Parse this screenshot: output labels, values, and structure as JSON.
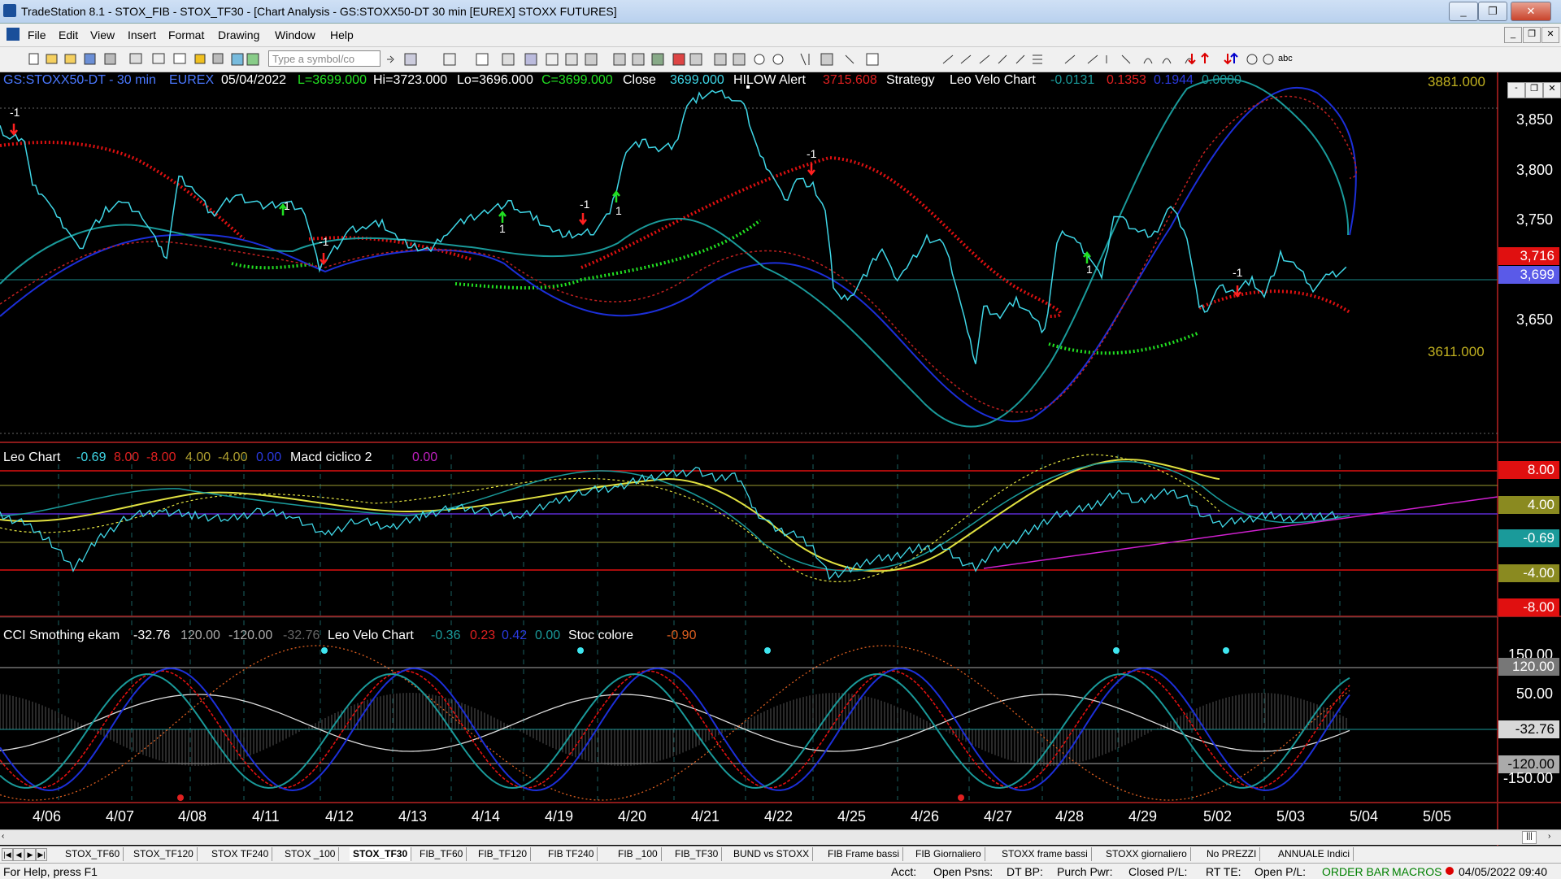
{
  "window": {
    "title": "TradeStation 8.1 - STOX_FIB - STOX_TF30 - [Chart Analysis - GS:STOXX50-DT  30 min  [EUREX] STOXX FUTURES]",
    "controls": [
      "_",
      "❐",
      "✕"
    ]
  },
  "menu": [
    "File",
    "Edit",
    "View",
    "Insert",
    "Format",
    "Drawing",
    "Window",
    "Help"
  ],
  "toolbar": {
    "symbol_placeholder": "Type a symbol/co",
    "abc_label": "abc"
  },
  "chart": {
    "header": {
      "symbol": "GS:STOXX50-DT - 30 min",
      "exchange": "EUREX",
      "date": "05/04/2022",
      "low_label": "L=3699.000",
      "hi_label": "Hi=3723.000",
      "lo_label": "Lo=3696.000",
      "close_label": "C=3699.000",
      "close_word": "Close",
      "close_value": "3699.000",
      "hilow_label": "HILOW Alert",
      "hilow_value": "3715.608",
      "strategy_label": "Strategy",
      "leovelo_label": "Leo Velo Chart",
      "leovelo_v1": "-0.0131",
      "leovelo_v2": "0.1353",
      "leovelo_v3": "0.1944",
      "leovelo_v4": "0.0000"
    },
    "price_levels": {
      "top": "3881.000",
      "bottom": "3611.000",
      "current_red": "3,716",
      "current_blue": "3,699"
    },
    "price_axis": [
      "3,850",
      "3,800",
      "3,750",
      "3,650"
    ],
    "markers": [
      "-1",
      "-1",
      "-1",
      "-1",
      "-1",
      "1",
      "1",
      "1",
      "1"
    ],
    "dates": [
      "4/06",
      "4/07",
      "4/08",
      "4/11",
      "4/12",
      "4/13",
      "4/14",
      "4/19",
      "4/20",
      "4/21",
      "4/22",
      "4/25",
      "4/26",
      "4/27",
      "4/28",
      "4/29",
      "5/02",
      "5/03",
      "5/04",
      "5/05"
    ],
    "colors": {
      "background": "#000000",
      "price_line": "#3fd6e6",
      "support_dots": "#22e022",
      "resistance_dots": "#e01010",
      "blue_line": "#1c2fd9",
      "teal_line": "#1a9a9a",
      "yellow_line": "#e0e040",
      "magenta_line": "#d020d0"
    }
  },
  "pane2": {
    "label": "Leo Chart",
    "v1": "-0.69",
    "v2": "8.00",
    "v3": "-8.00",
    "v4": "4.00",
    "v5": "-4.00",
    "v6": "0.00",
    "macd_label": "Macd ciclico 2",
    "macd_value": "0.00",
    "axis": [
      "8.00",
      "4.00",
      "-0.69",
      "-4.00",
      "-8.00"
    ]
  },
  "pane3": {
    "cci_label": "CCI Smothing ekam",
    "cci_v1": "-32.76",
    "cci_v2": "120.00",
    "cci_v3": "-120.00",
    "cci_v4": "-32.76",
    "leovelo_label": "Leo Velo Chart",
    "lv1": "-0.36",
    "lv2": "0.23",
    "lv3": "0.42",
    "lv4": "0.00",
    "stoc_label": "Stoc colore",
    "stoc_value": "-0.90",
    "axis": [
      "150.00",
      "120.00",
      "50.00",
      "-32.76",
      "-120.00",
      "-150.00"
    ]
  },
  "tabs": [
    "STOX_TF60",
    "STOX_TF120",
    "STOX TF240",
    "STOX _100",
    "STOX_TF30",
    "FIB_TF60",
    "FIB_TF120",
    "FIB TF240",
    "FIB _100",
    "FIB_TF30",
    "BUND vs STOXX",
    "FIB Frame bassi",
    "FIB Giornaliero",
    "STOXX frame bassi",
    "STOXX giornaliero",
    "No PREZZI",
    "ANNUALE Indici"
  ],
  "status": {
    "help": "For Help, press F1",
    "acct": "Acct:",
    "open_psns": "Open Psns:",
    "dt_bp": "DT BP:",
    "purch_pwr": "Purch Pwr:",
    "closed_pl": "Closed P/L:",
    "rt_te": "RT TE:",
    "open_pl": "Open P/L:",
    "order_bar": "ORDER BAR",
    "macros": "MACROS",
    "datetime": "04/05/2022 09:40"
  }
}
